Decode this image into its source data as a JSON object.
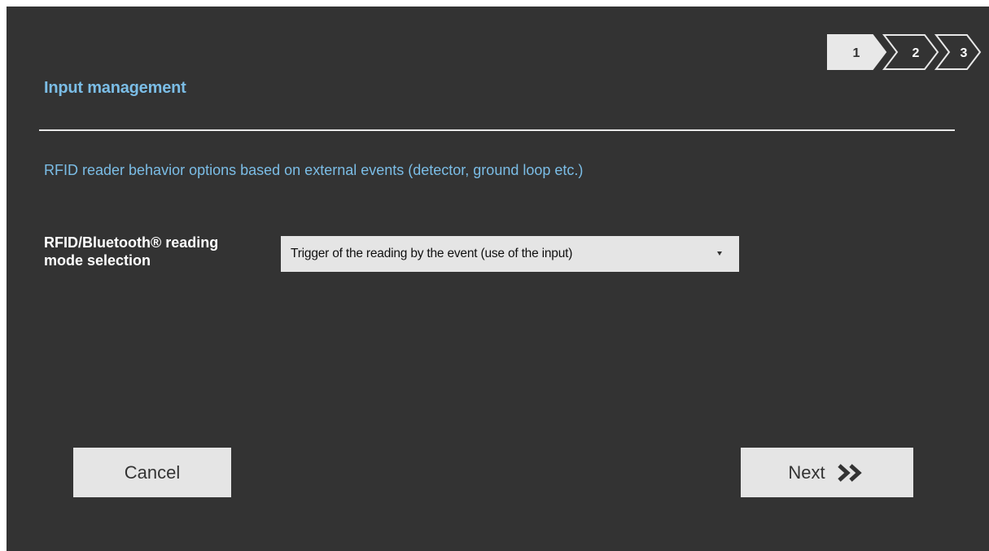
{
  "stepper": {
    "steps": [
      {
        "label": "1",
        "active": true
      },
      {
        "label": "2",
        "active": false
      },
      {
        "label": "3",
        "active": false
      }
    ]
  },
  "header": {
    "title": "Input management"
  },
  "main": {
    "subtitle": "RFID reader behavior options based on external events (detector, ground loop etc.)",
    "reading_mode": {
      "label_line1": "RFID/Bluetooth® reading",
      "label_line2": "mode selection",
      "selected_value": "Trigger of the reading by the event (use of the input)"
    }
  },
  "footer": {
    "cancel_label": "Cancel",
    "next_label": "Next"
  },
  "colors": {
    "background": "#333333",
    "accent_text": "#7bbde6",
    "button_bg": "#e5e5e5"
  }
}
